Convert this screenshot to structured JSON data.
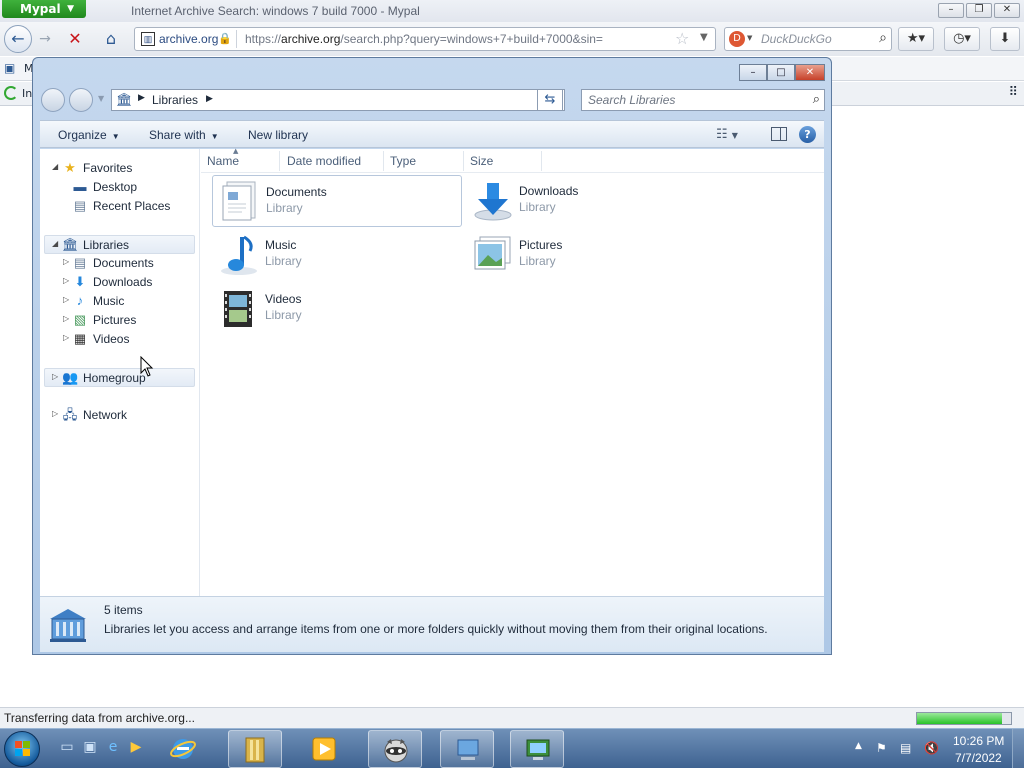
{
  "browser": {
    "app_menu_label": "Mypal",
    "window_title": "Internet Archive Search: windows 7 build 7000 - Mypal",
    "site_identity": "archive.org",
    "url_prefix": "https://",
    "url_domain": "archive.org",
    "url_path": "/search.php?query=windows+7+build+7000&sin=",
    "search_placeholder": "DuckDuckGo",
    "bookmark_label": "M",
    "tab_label": "In",
    "status_text": "Transferring data from archive.org...",
    "progress_fraction": 0.9
  },
  "explorer": {
    "breadcrumb": "Libraries",
    "search_placeholder": "Search Libraries",
    "commands": {
      "organize": "Organize",
      "share_with": "Share with",
      "new_library": "New library"
    },
    "nav": {
      "favorites": "Favorites",
      "desktop": "Desktop",
      "recent_places": "Recent Places",
      "libraries": "Libraries",
      "documents": "Documents",
      "downloads": "Downloads",
      "music": "Music",
      "pictures": "Pictures",
      "videos": "Videos",
      "homegroup": "Homegroup",
      "network": "Network"
    },
    "columns": {
      "name": "Name",
      "date_modified": "Date modified",
      "type": "Type",
      "size": "Size"
    },
    "libraries": [
      {
        "name": "Documents",
        "type": "Library"
      },
      {
        "name": "Downloads",
        "type": "Library"
      },
      {
        "name": "Music",
        "type": "Library"
      },
      {
        "name": "Pictures",
        "type": "Library"
      },
      {
        "name": "Videos",
        "type": "Library"
      }
    ],
    "details": {
      "count": "5 items",
      "description": "Libraries let you access and arrange items from one or more folders quickly without moving them from their original locations."
    }
  },
  "taskbar": {
    "time": "10:26 PM",
    "date": "7/7/2022"
  },
  "colors": {
    "mypal_green": "#2f9e2b",
    "explorer_frame": "#b8cfe9",
    "taskbar": "#4d6f9c",
    "accent_blue": "#2d5a93"
  }
}
